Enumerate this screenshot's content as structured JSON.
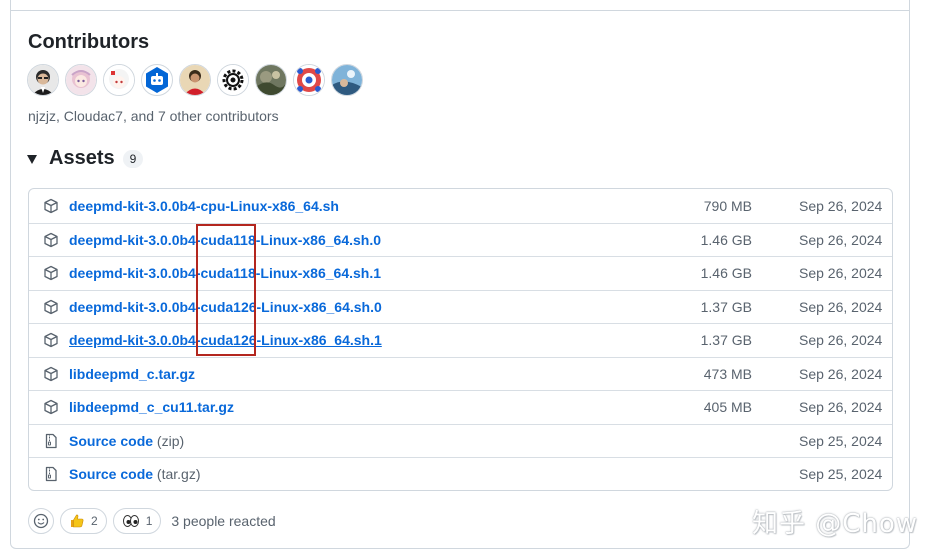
{
  "contributors": {
    "title": "Contributors",
    "summary": "njzjz, Cloudac7, and 7 other contributors",
    "avatars": [
      "avatar-person-glasses-icon",
      "avatar-anime-pink-icon",
      "avatar-anime-white-icon",
      "avatar-bot-icon",
      "avatar-person-red-icon",
      "avatar-gear-icon",
      "avatar-landscape-icon",
      "avatar-pattern-icon",
      "avatar-sky-icon"
    ]
  },
  "assets": {
    "title": "Assets",
    "count": "9",
    "items": [
      {
        "pre": "deepmd-kit-3.0.0b4-cpu-Linux-x86_64.sh",
        "suffix": "",
        "size": "790 MB",
        "date": "Sep 26, 2024",
        "icon": "package-icon"
      },
      {
        "pre": "deepmd-kit-3.0.0b4-cuda118-Linux-x86_64.sh.0",
        "suffix": "",
        "size": "1.46 GB",
        "date": "Sep 26, 2024",
        "icon": "package-icon"
      },
      {
        "pre": "deepmd-kit-3.0.0b4-cuda118-Linux-x86_64.sh.1",
        "suffix": "",
        "size": "1.46 GB",
        "date": "Sep 26, 2024",
        "icon": "package-icon"
      },
      {
        "pre": "deepmd-kit-3.0.0b4-cuda126-Linux-x86_64.sh.0",
        "suffix": "",
        "size": "1.37 GB",
        "date": "Sep 26, 2024",
        "icon": "package-icon"
      },
      {
        "pre": "deepmd-kit-3.0.0b4-cuda126-Linux-x86_64.sh.1",
        "suffix": "",
        "size": "1.37 GB",
        "date": "Sep 26, 2024",
        "icon": "package-icon"
      },
      {
        "pre": "libdeepmd_c.tar.gz",
        "suffix": "",
        "size": "473 MB",
        "date": "Sep 26, 2024",
        "icon": "package-icon"
      },
      {
        "pre": "libdeepmd_c_cu11.tar.gz",
        "suffix": "",
        "size": "405 MB",
        "date": "Sep 26, 2024",
        "icon": "package-icon"
      },
      {
        "pre": "Source code",
        "suffix": " (zip)",
        "size": "",
        "date": "Sep 25, 2024",
        "icon": "file-zip-icon"
      },
      {
        "pre": "Source code",
        "suffix": " (tar.gz)",
        "size": "",
        "date": "Sep 25, 2024",
        "icon": "file-zip-icon"
      }
    ]
  },
  "reactions": {
    "thumbs_count": "2",
    "eyes_count": "1",
    "summary": "3 people reacted"
  },
  "watermark": "知乎 @Chow",
  "colors": {
    "link": "#0969da",
    "muted": "#59636e",
    "border": "#d0d7de",
    "highlight": "#b3261e"
  }
}
